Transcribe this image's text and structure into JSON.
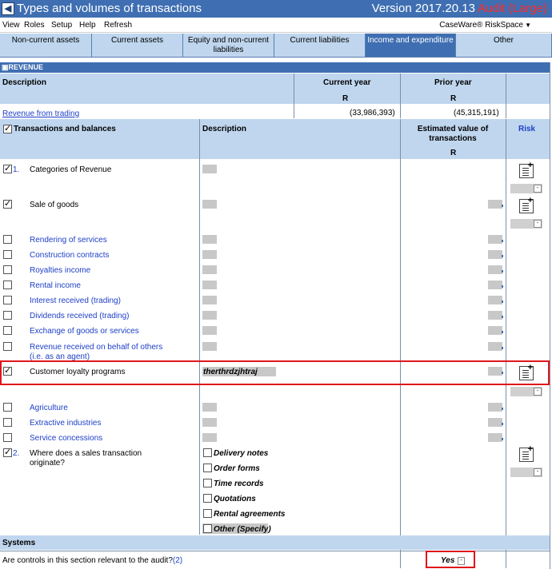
{
  "window": {
    "title": "Types and volumes of transactions",
    "version": "Version 2017.20.13",
    "audit": "Audit (Large)",
    "icon": "back-arrow-icon"
  },
  "menu": [
    "View",
    "Roles",
    "Setup",
    "Help",
    "Refresh"
  ],
  "brand": "CaseWare® RiskSpace",
  "tabs": [
    {
      "label": "Non-current assets"
    },
    {
      "label": "Current assets"
    },
    {
      "label": "Equity and non-current liabilities"
    },
    {
      "label": "Current liabilities"
    },
    {
      "label": "Income and expenditure"
    },
    {
      "label": "Other"
    }
  ],
  "section": "REVENUE",
  "summary": {
    "description_header": "Description",
    "current_year_header": "Current year",
    "prior_year_header": "Prior year",
    "currency": "R",
    "row_label": "Revenue from trading",
    "current_value": "(33,986,393)",
    "prior_value": "(45,315,191)"
  },
  "table": {
    "col_transactions": "Transactions and balances",
    "col_description": "Description",
    "col_estimated": "Estimated value of transactions",
    "col_currency": "R",
    "col_risk": "Risk"
  },
  "rows": [
    {
      "label": "Categories of Revenue",
      "number": "1.",
      "checked": true
    },
    {
      "label": "Sale of goods",
      "checked": true
    },
    {
      "label": "Rendering of services",
      "checked": false
    },
    {
      "label": "Construction contracts",
      "checked": false
    },
    {
      "label": "Royalties income",
      "checked": false
    },
    {
      "label": "Rental income",
      "checked": false
    },
    {
      "label": "Interest received (trading)",
      "checked": false
    },
    {
      "label": "Dividends received (trading)",
      "checked": false
    },
    {
      "label": "Exchange of goods or services",
      "checked": false
    },
    {
      "label": "Revenue received on behalf of others (i.e. as an agent)",
      "checked": false
    },
    {
      "label": "Customer loyalty programs",
      "checked": true,
      "description": "therthrdzjhtraj"
    },
    {
      "label": "Agriculture",
      "checked": false
    },
    {
      "label": "Extractive industries",
      "checked": false
    },
    {
      "label": "Service concessions",
      "checked": false
    },
    {
      "label": "Where does a sales transaction originate?",
      "number": "2.",
      "checked": true
    }
  ],
  "origin_options": [
    "Delivery notes",
    "Order forms",
    "Time records",
    "Quotations",
    "Rental agreements",
    "Other (Specify)"
  ],
  "systems": {
    "header": "Systems",
    "question": "Are controls in this section relevant to the audit?",
    "ref": "(2)",
    "answer": "Yes"
  }
}
